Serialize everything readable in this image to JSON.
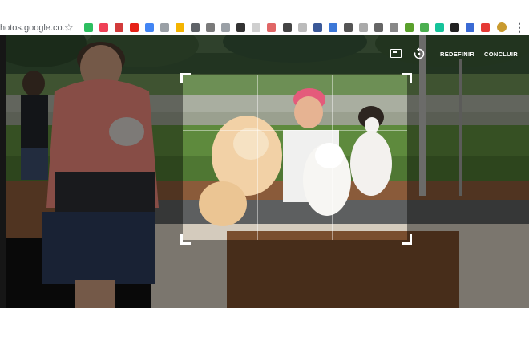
{
  "browser": {
    "url_text": "hotos.google.co...",
    "extension_icons": [
      {
        "name": "evernote-icon",
        "color": "#2dbe60"
      },
      {
        "name": "pocket-icon",
        "color": "#ef4056"
      },
      {
        "name": "t-icon",
        "color": "#d23b3b"
      },
      {
        "name": "youtube-icon",
        "color": "#e62117"
      },
      {
        "name": "translate-icon",
        "color": "#4285f4"
      },
      {
        "name": "circle-icon",
        "color": "#9aa0a6"
      },
      {
        "name": "note-icon",
        "color": "#f4b400"
      },
      {
        "name": "tab-icon",
        "color": "#5f6368"
      },
      {
        "name": "image-icon",
        "color": "#7a7a7a"
      },
      {
        "name": "square-icon",
        "color": "#9aa0a6"
      },
      {
        "name": "p-icon",
        "color": "#333333"
      },
      {
        "name": "ghost-icon",
        "color": "#cfcfcf"
      },
      {
        "name": "dots-icon",
        "color": "#e06666"
      },
      {
        "name": "bird-icon",
        "color": "#444444"
      },
      {
        "name": "page-icon",
        "color": "#bbbbbb"
      },
      {
        "name": "doc-icon",
        "color": "#3b5998"
      },
      {
        "name": "globe-icon",
        "color": "#3c78d8"
      },
      {
        "name": "qr-icon",
        "color": "#555555"
      },
      {
        "name": "gray-square-icon",
        "color": "#aaaaaa"
      },
      {
        "name": "news-icon",
        "color": "#666666"
      },
      {
        "name": "puzzle-icon",
        "color": "#888888"
      },
      {
        "name": "mail-icon",
        "color": "#5aa02c"
      },
      {
        "name": "download-icon",
        "color": "#4caf50"
      },
      {
        "name": "grammarly-icon",
        "color": "#15c39a"
      },
      {
        "name": "moon-icon",
        "color": "#222222"
      },
      {
        "name": "wave-icon",
        "color": "#3a6ad4"
      },
      {
        "name": "calendar-icon",
        "color": "#e53935"
      }
    ],
    "star_icon": "star-outline-icon",
    "avatar_icon": "profile-avatar-icon",
    "menu_icon": "vertical-dots-icon"
  },
  "editor": {
    "aspect_icon": "aspect-ratio-icon",
    "rotate_icon": "rotate-icon",
    "reset_label": "REDEFINIR",
    "done_label": "CONCLUIR"
  },
  "colors": {
    "viewer_bg": "#111111",
    "crop_border": "#ffffff"
  }
}
